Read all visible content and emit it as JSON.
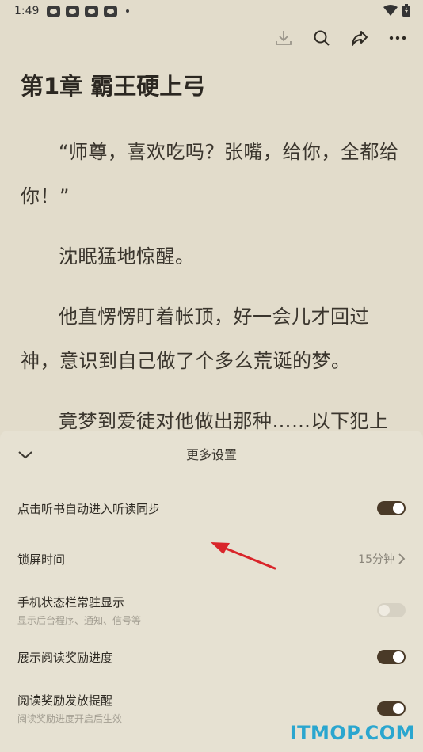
{
  "status": {
    "time": "1:49",
    "app_icons": [
      "app-icon",
      "app-icon",
      "app-icon",
      "app-icon"
    ]
  },
  "toolbar": {
    "icons": [
      "download-icon",
      "search-icon",
      "share-icon",
      "more-icon"
    ]
  },
  "reader": {
    "chapter_title": "第1章 霸王硬上弓",
    "paragraphs": [
      "“师尊，喜欢吃吗？张嘴，给你，全都给你！”",
      "沈眠猛地惊醒。",
      "他直愣愣盯着帐顶，好一会儿才回过神，意识到自己做了个多么荒诞的梦。",
      "竟梦到爱徒对他做出那种……以下犯上"
    ]
  },
  "panel": {
    "title": "更多设置",
    "rows": [
      {
        "label": "点击听书自动进入听读同步",
        "toggle": "on"
      },
      {
        "label": "锁屏时间",
        "value": "15分钟"
      },
      {
        "label": "手机状态栏常驻显示",
        "sub": "显示后台程序、通知、信号等",
        "toggle": "off"
      },
      {
        "label": "展示阅读奖励进度",
        "toggle": "on"
      },
      {
        "label": "阅读奖励发放提醒",
        "sub": "阅读奖励进度开启后生效",
        "toggle": "on"
      }
    ]
  },
  "colors": {
    "background": "#e2dccb",
    "toggle_on": "#4a3a28",
    "annotation_arrow": "#d9252a",
    "watermark": "#2aa6cf"
  },
  "watermark": "ITMOP.COM"
}
